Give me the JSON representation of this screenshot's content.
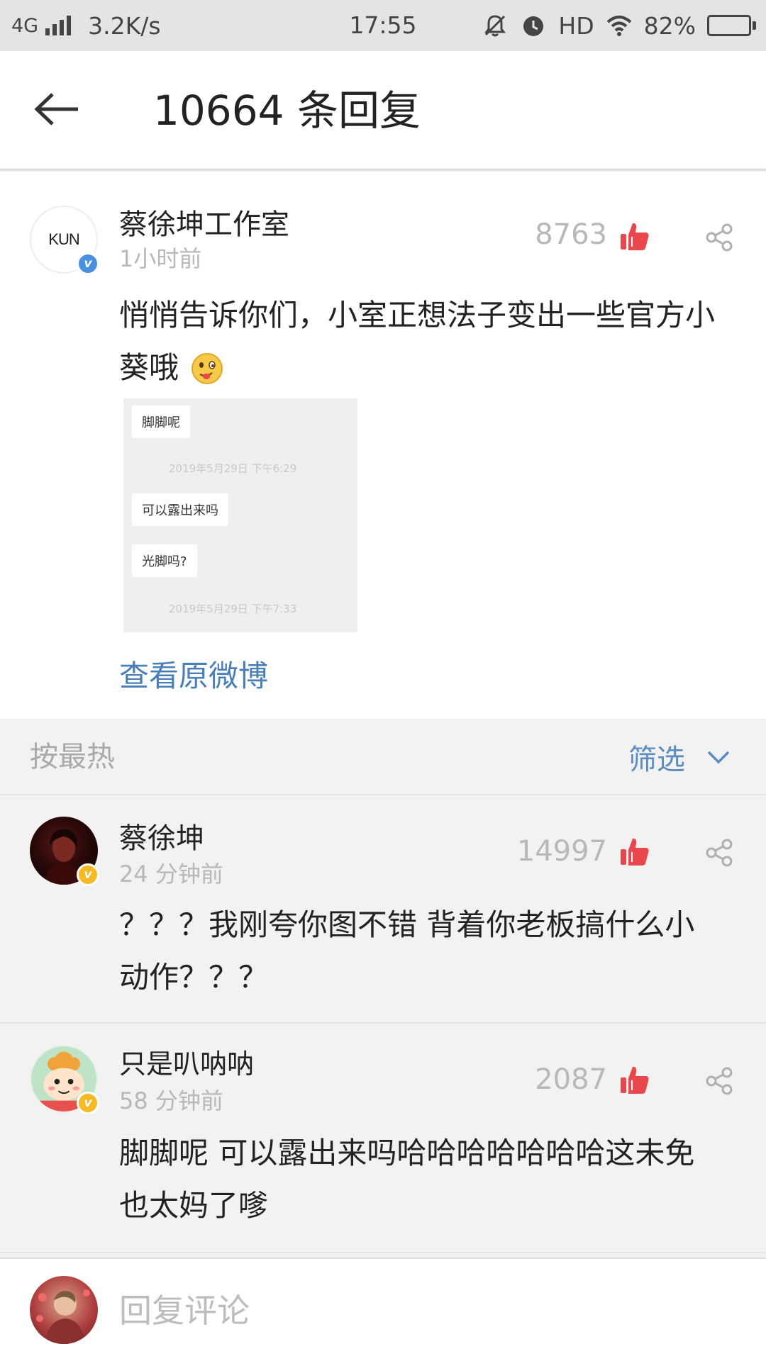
{
  "status_bar": {
    "network": "4G",
    "speed": "3.2K/s",
    "time": "17:55",
    "hd": "HD",
    "battery": "82%",
    "battery_level": 0.82
  },
  "header": {
    "title": "10664 条回复"
  },
  "original_post": {
    "avatar_text": "KUN",
    "username": "蔡徐坤工作室",
    "time": "1小时前",
    "likes": "8763",
    "text": "悄悄告诉你们，小室正想法子变出一些官方小葵哦",
    "image": {
      "bubble1": "脚脚呢",
      "timestamp1": "2019年5月29日 下午6:29",
      "bubble2": "可以露出来吗",
      "bubble3": "光脚吗?",
      "timestamp2": "2019年5月29日 下午7:33"
    },
    "view_original": "查看原微博"
  },
  "sort_bar": {
    "label": "按最热",
    "filter": "筛选"
  },
  "comments": [
    {
      "username": "蔡徐坤",
      "time": "24 分钟前",
      "likes": "14997",
      "text": "？？？我刚夸你图不错 背着你老板搞什么小动作？？？"
    },
    {
      "username": "只是叭呐呐",
      "time": "58 分钟前",
      "likes": "2087",
      "text": "脚脚呢 可以露出来吗哈哈哈哈哈哈哈这未免也太妈了嗲"
    }
  ],
  "reply_bar": {
    "placeholder": "回复评论"
  },
  "colors": {
    "like_red": "#e8474d",
    "link_blue": "#4a7eb8",
    "verified_blue": "#4a90e2",
    "verified_gold": "#f5b923"
  }
}
